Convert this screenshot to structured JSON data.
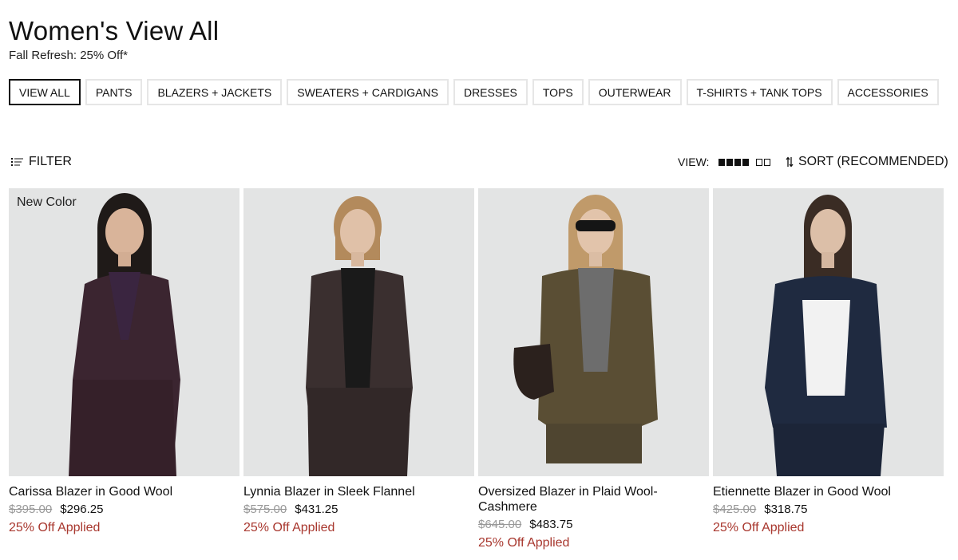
{
  "header": {
    "title": "Women's View All",
    "subtitle": "Fall Refresh: 25% Off*"
  },
  "categories": [
    {
      "label": "VIEW ALL",
      "active": true
    },
    {
      "label": "PANTS"
    },
    {
      "label": "BLAZERS + JACKETS"
    },
    {
      "label": "SWEATERS + CARDIGANS"
    },
    {
      "label": "DRESSES"
    },
    {
      "label": "TOPS"
    },
    {
      "label": "OUTERWEAR"
    },
    {
      "label": "T-SHIRTS + TANK TOPS"
    },
    {
      "label": "ACCESSORIES"
    }
  ],
  "toolbar": {
    "filter_label": "FILTER",
    "view_label": "VIEW:",
    "sort_label": "SORT (RECOMMENDED)",
    "icons": [
      "filter-list-icon",
      "grid-four-icon",
      "grid-two-icon",
      "sort-arrows-icon"
    ]
  },
  "products": [
    {
      "badge": "New Color",
      "name": "Carissa Blazer in Good Wool",
      "original_price": "$395.00",
      "sale_price": "$296.25",
      "promo": "25% Off Applied",
      "jacket_color": "#3b2530",
      "inner_color": "#3a2540",
      "hair_color": "#1f1a18"
    },
    {
      "badge": "",
      "name": "Lynnia Blazer in Sleek Flannel",
      "original_price": "$575.00",
      "sale_price": "$431.25",
      "promo": "25% Off Applied",
      "jacket_color": "#3a2f2f",
      "inner_color": "#1a1a1a",
      "hair_color": "#b38a5c"
    },
    {
      "badge": "",
      "name": "Oversized Blazer in Plaid Wool-Cashmere",
      "original_price": "$645.00",
      "sale_price": "$483.75",
      "promo": "25% Off Applied",
      "jacket_color": "#5a4e34",
      "inner_color": "#6d6d6d",
      "hair_color": "#c09a6a"
    },
    {
      "badge": "",
      "name": "Etiennette Blazer in Good Wool",
      "original_price": "$425.00",
      "sale_price": "$318.75",
      "promo": "25% Off Applied",
      "jacket_color": "#1f2a40",
      "inner_color": "#f2f2f2",
      "hair_color": "#3a2c24"
    }
  ],
  "colors": {
    "promo": "#a8372e",
    "image_bg": "#e3e4e4",
    "border": "#e6e6e6"
  }
}
